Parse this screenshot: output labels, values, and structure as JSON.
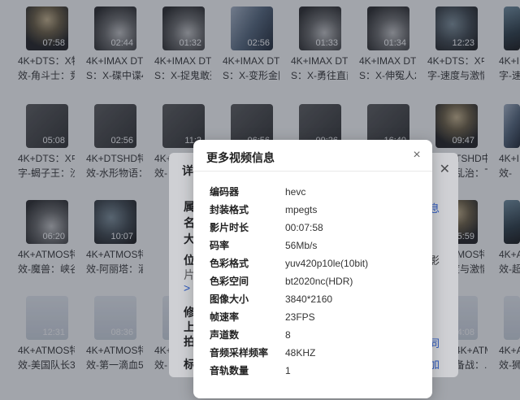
{
  "videos": [
    {
      "duration": "07:58",
      "line1": "4K+DTS：X特",
      "line2": "效-角斗士：竞..."
    },
    {
      "duration": "02:44",
      "line1": "4K+IMAX DT",
      "line2": "S：X-碟中谍4..."
    },
    {
      "duration": "01:32",
      "line1": "4K+IMAX DT",
      "line2": "S：X-捉鬼敢死..."
    },
    {
      "duration": "02:56",
      "line1": "4K+IMAX DT",
      "line2": "S：X-变形金刚..."
    },
    {
      "duration": "01:33",
      "line1": "4K+IMAX DT",
      "line2": "S：X-勇往直前..."
    },
    {
      "duration": "01:34",
      "line1": "4K+IMAX DT",
      "line2": "S：X-伸冤人2..."
    },
    {
      "duration": "12:23",
      "line1": "4K+DTS：X中",
      "line2": "字-速度与激情..."
    },
    {
      "duration": "",
      "line1": "4K+I",
      "line2": "字-速"
    },
    {
      "duration": "05:08",
      "line1": "4K+DTS：X中",
      "line2": "字-蝎子王：沙..."
    },
    {
      "duration": "02:56",
      "line1": "4K+DTSHD特",
      "line2": "效-水形物语：..."
    },
    {
      "duration": "11:2",
      "line1": "4K+",
      "line2": "效-"
    },
    {
      "duration": "06:56",
      "line1": "",
      "line2": ""
    },
    {
      "duration": "09:26",
      "line1": "",
      "line2": ""
    },
    {
      "duration": "16:40",
      "line1": "",
      "line2": ""
    },
    {
      "duration": "09:47",
      "line1": "TSHD中",
      "line2": "乱治：飞..."
    },
    {
      "duration": "",
      "line1": "4K+I",
      "line2": "效-"
    },
    {
      "duration": "06:20",
      "line1": "4K+ATMOS特",
      "line2": "效-魔兽：峡谷..."
    },
    {
      "duration": "10:07",
      "line1": "4K+ATMOS特",
      "line2": "效-阿丽塔：酒..."
    },
    {
      "duration": "",
      "line1": "",
      "line2": ""
    },
    {
      "duration": "",
      "line1": "",
      "line2": ""
    },
    {
      "duration": "",
      "line1": "",
      "line2": ""
    },
    {
      "duration": "",
      "line1": "",
      "line2": ""
    },
    {
      "duration": "05:59",
      "line1": "4K+ATMOS特",
      "line2": "字-速度与激情..."
    },
    {
      "duration": "",
      "line1": "4K+A",
      "line2": "效-超"
    },
    {
      "duration": "12:31",
      "line1": "4K+ATMOS特",
      "line2": "效-美国队长3..."
    },
    {
      "duration": "08:36",
      "line1": "4K+ATMOS特",
      "line2": "效-第一滴血5..."
    },
    {
      "duration": "",
      "line1": "4K+",
      "line2": "效-"
    },
    {
      "duration": "",
      "line1": "",
      "line2": ""
    },
    {
      "duration": "",
      "line1": "",
      "line2": ""
    },
    {
      "duration": "",
      "line1": "",
      "line2": ""
    },
    {
      "duration": "04:08",
      "line1": "4K+ATMOS特",
      "line2": "备战：..."
    },
    {
      "duration": "",
      "line1": "4K+A",
      "line2": "效-狮"
    }
  ],
  "back_dialog": {
    "title": "详",
    "left_labels": [
      "属",
      "名",
      "大",
      "位",
      "片",
      "修",
      "上",
      "拍",
      "标"
    ],
    "arrow": ">",
    "right_labels": [
      "息",
      "影",
      "同",
      "加"
    ]
  },
  "dialog": {
    "title": "更多视频信息",
    "close": "×",
    "rows": [
      {
        "label": "编码器",
        "value": "hevc"
      },
      {
        "label": "封装格式",
        "value": "mpegts"
      },
      {
        "label": "影片时长",
        "value": "00:07:58"
      },
      {
        "label": "码率",
        "value": "56Mb/s"
      },
      {
        "label": "色彩格式",
        "value": "yuv420p10le(10bit)"
      },
      {
        "label": "色彩空间",
        "value": "bt2020nc(HDR)"
      },
      {
        "label": "图像大小",
        "value": "3840*2160"
      },
      {
        "label": "帧速率",
        "value": "23FPS"
      },
      {
        "label": "声道数",
        "value": "8"
      },
      {
        "label": "音频采样频率",
        "value": "48KHZ"
      },
      {
        "label": "音轨数量",
        "value": "1"
      }
    ]
  }
}
